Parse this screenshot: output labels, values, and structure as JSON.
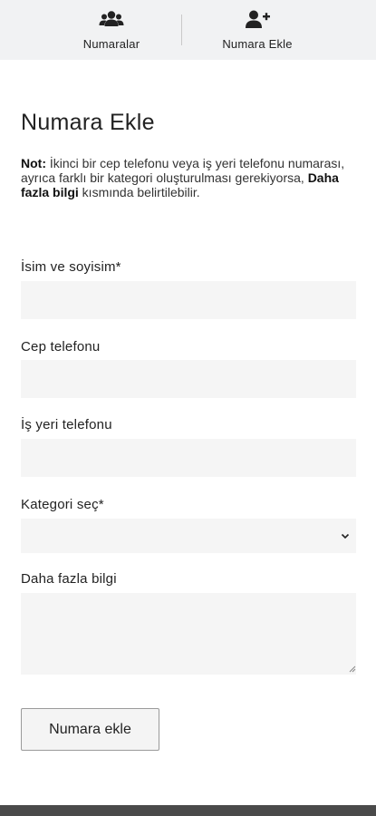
{
  "nav": {
    "items": [
      {
        "label": "Numaralar",
        "icon": "users-icon"
      },
      {
        "label": "Numara Ekle",
        "icon": "user-plus-icon"
      }
    ]
  },
  "page": {
    "title": "Numara Ekle",
    "note": {
      "prefix": "Not:",
      "text": " İkinci bir cep telefonu veya iş yeri telefonu numarası, ayrıca farklı bir kategori oluşturulması gerekiyorsa, ",
      "highlight": "Daha fazla bilgi",
      "suffix": " kısmında belirtilebilir."
    }
  },
  "form": {
    "name_label": "İsim ve soyisim*",
    "name_value": "",
    "mobile_label": "Cep telefonu",
    "mobile_value": "",
    "work_label": "İş yeri telefonu",
    "work_value": "",
    "category_label": "Kategori seç*",
    "category_value": "",
    "info_label": "Daha fazla bilgi",
    "info_value": "",
    "submit_label": "Numara ekle"
  },
  "colors": {
    "nav_background": "#f1f2f3",
    "field_background": "#f5f5f5",
    "bottom_bar": "#4a4a4a"
  }
}
